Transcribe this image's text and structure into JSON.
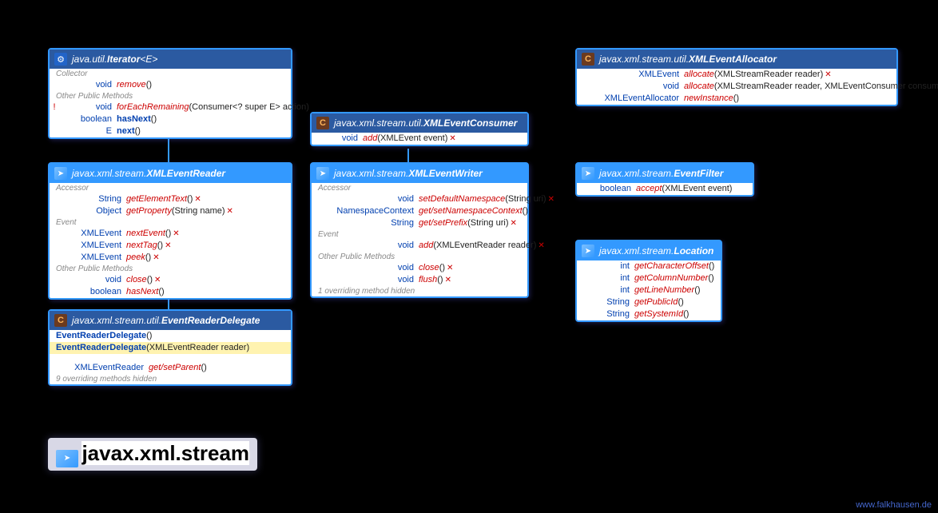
{
  "iterator": {
    "pkg": "java.util.",
    "cls": "Iterator",
    "generic": "<E>",
    "sections": [
      {
        "label": "Collector",
        "rows": [
          {
            "rt": "void",
            "nm": "remove",
            "args": "()"
          }
        ]
      },
      {
        "label": "Other Public Methods",
        "rows": [
          {
            "mark": "!",
            "rt": "void",
            "nm": "forEachRemaining",
            "args": "(Consumer<? super E> action)"
          },
          {
            "rt": "boolean",
            "nm": "hasNext",
            "args": "()",
            "nmStyle": "blue"
          },
          {
            "rt": "E",
            "nm": "next",
            "args": "()",
            "nmStyle": "blue"
          }
        ]
      }
    ]
  },
  "eventReader": {
    "pkg": "javax.xml.stream.",
    "cls": "XMLEventReader",
    "sections": [
      {
        "label": "Accessor",
        "rows": [
          {
            "rt": "String",
            "nm": "getElementText",
            "args": "()",
            "throws": "✕"
          },
          {
            "rt": "Object",
            "nm": "getProperty",
            "args": "(String name)",
            "throws": "✕"
          }
        ]
      },
      {
        "label": "Event",
        "rows": [
          {
            "rt": "XMLEvent",
            "nm": "nextEvent",
            "args": "()",
            "throws": "✕"
          },
          {
            "rt": "XMLEvent",
            "nm": "nextTag",
            "args": "()",
            "throws": "✕"
          },
          {
            "rt": "XMLEvent",
            "nm": "peek",
            "args": "()",
            "throws": "✕"
          }
        ]
      },
      {
        "label": "Other Public Methods",
        "rows": [
          {
            "rt": "void",
            "nm": "close",
            "args": "()",
            "throws": "✕"
          },
          {
            "rt": "boolean",
            "nm": "hasNext",
            "args": "()"
          }
        ]
      }
    ]
  },
  "delegate": {
    "pkg": "javax.xml.stream.util.",
    "cls": "EventReaderDelegate",
    "ctors": [
      {
        "nm": "EventReaderDelegate",
        "args": "()"
      },
      {
        "nm": "EventReaderDelegate",
        "args": "(XMLEventReader reader)"
      }
    ],
    "rows": [
      {
        "rt": "XMLEventReader",
        "nm": "get/setParent",
        "args": "()"
      }
    ],
    "hidden": "9 overriding methods hidden"
  },
  "consumer": {
    "pkg": "javax.xml.stream.util.",
    "cls": "XMLEventConsumer",
    "rows": [
      {
        "rt": "void",
        "nm": "add",
        "args": "(XMLEvent event)",
        "throws": "✕"
      }
    ]
  },
  "writer": {
    "pkg": "javax.xml.stream.",
    "cls": "XMLEventWriter",
    "sections": [
      {
        "label": "Accessor",
        "rows": [
          {
            "rt": "void",
            "nm": "setDefaultNamespace",
            "args": "(String uri)",
            "throws": "✕"
          },
          {
            "rt": "NamespaceContext",
            "nm": "get/setNamespaceContext",
            "args": "()"
          },
          {
            "rt": "String",
            "nm": "get/setPrefix",
            "args": "(String uri)",
            "throws": "✕"
          }
        ]
      },
      {
        "label": "Event",
        "rows": [
          {
            "rt": "void",
            "nm": "add",
            "args": "(XMLEventReader reader)",
            "throws": "✕"
          }
        ]
      },
      {
        "label": "Other Public Methods",
        "rows": [
          {
            "rt": "void",
            "nm": "close",
            "args": "()",
            "throws": "✕"
          },
          {
            "rt": "void",
            "nm": "flush",
            "args": "()",
            "throws": "✕"
          }
        ]
      }
    ],
    "hidden": "1 overriding method hidden"
  },
  "allocator": {
    "pkg": "javax.xml.stream.util.",
    "cls": "XMLEventAllocator",
    "rows": [
      {
        "rt": "XMLEvent",
        "nm": "allocate",
        "args": "(XMLStreamReader reader)",
        "throws": "✕"
      },
      {
        "rt": "void",
        "nm": "allocate",
        "args": "(XMLStreamReader reader, XMLEventConsumer consumer)",
        "throws": "✕"
      },
      {
        "rt": "XMLEventAllocator",
        "nm": "newInstance",
        "args": "()"
      }
    ]
  },
  "filter": {
    "pkg": "javax.xml.stream.",
    "cls": "EventFilter",
    "rows": [
      {
        "rt": "boolean",
        "nm": "accept",
        "args": "(XMLEvent event)"
      }
    ]
  },
  "location": {
    "pkg": "javax.xml.stream.",
    "cls": "Location",
    "rows": [
      {
        "rt": "int",
        "nm": "getCharacterOffset",
        "args": "()"
      },
      {
        "rt": "int",
        "nm": "getColumnNumber",
        "args": "()"
      },
      {
        "rt": "int",
        "nm": "getLineNumber",
        "args": "()"
      },
      {
        "rt": "String",
        "nm": "getPublicId",
        "args": "()"
      },
      {
        "rt": "String",
        "nm": "getSystemId",
        "args": "()"
      }
    ]
  },
  "title": "javax.xml.stream",
  "credit": "www.falkhausen.de"
}
